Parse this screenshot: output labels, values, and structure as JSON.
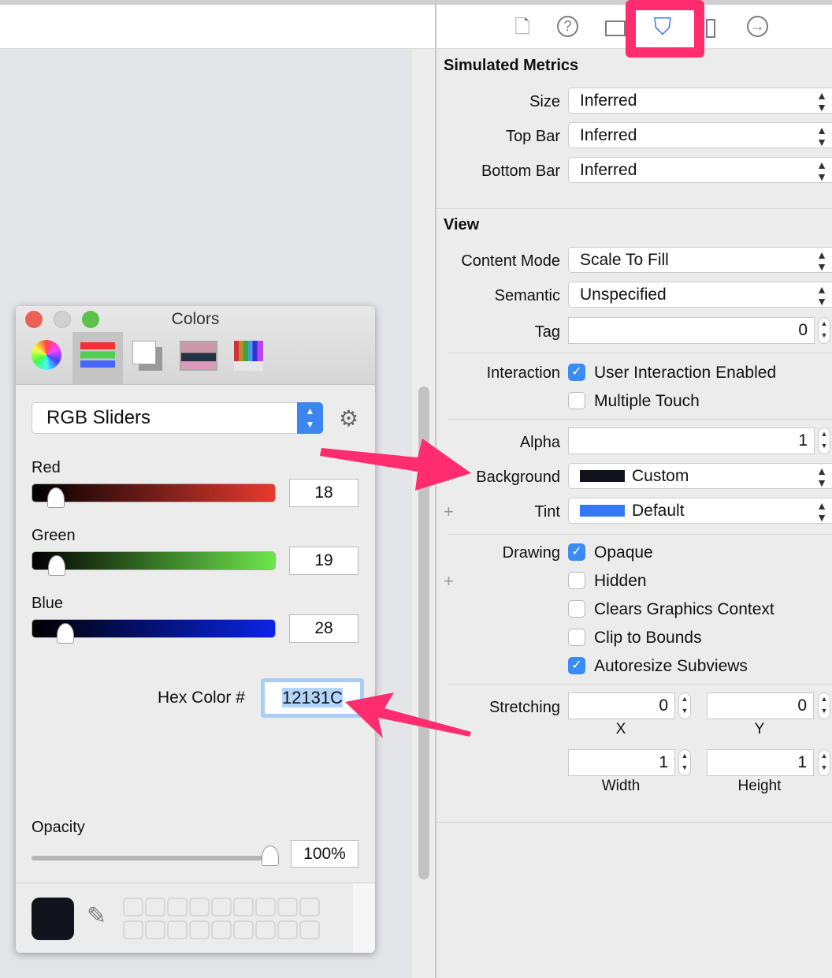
{
  "toolbar": {
    "icons": [
      "file-icon",
      "help-icon",
      "identity-icon",
      "attributes-icon",
      "size-ruler-icon",
      "connections-icon"
    ],
    "selected": "attributes-icon",
    "highlight_color": "#ff2d6f"
  },
  "inspector": {
    "simulated_metrics": {
      "title": "Simulated Metrics",
      "rows": [
        {
          "label": "Size",
          "value": "Inferred"
        },
        {
          "label": "Top Bar",
          "value": "Inferred"
        },
        {
          "label": "Bottom Bar",
          "value": "Inferred"
        }
      ]
    },
    "view": {
      "title": "View",
      "content_mode": {
        "label": "Content Mode",
        "value": "Scale To Fill"
      },
      "semantic": {
        "label": "Semantic",
        "value": "Unspecified"
      },
      "tag": {
        "label": "Tag",
        "value": "0"
      },
      "interaction": {
        "label": "Interaction",
        "options": [
          {
            "label": "User Interaction Enabled",
            "checked": true
          },
          {
            "label": "Multiple Touch",
            "checked": false
          }
        ]
      },
      "alpha": {
        "label": "Alpha",
        "value": "1"
      },
      "background": {
        "label": "Background",
        "value": "Custom",
        "swatch": "#12131c"
      },
      "tint": {
        "label": "Tint",
        "value": "Default",
        "swatch": "#3478f6"
      },
      "drawing": {
        "label": "Drawing",
        "options": [
          {
            "label": "Opaque",
            "checked": true
          },
          {
            "label": "Hidden",
            "checked": false
          },
          {
            "label": "Clears Graphics Context",
            "checked": false
          },
          {
            "label": "Clip to Bounds",
            "checked": false
          },
          {
            "label": "Autoresize Subviews",
            "checked": true
          }
        ]
      },
      "stretching": {
        "label": "Stretching",
        "x": "0",
        "x_label": "X",
        "y": "0",
        "y_label": "Y",
        "width": "1",
        "width_label": "Width",
        "height": "1",
        "height_label": "Height"
      }
    }
  },
  "colors_panel": {
    "title": "Colors",
    "mode": "RGB Sliders",
    "tabs": [
      "color-wheel-icon",
      "sliders-icon",
      "palettes-icon",
      "image-palette-icon",
      "pencils-icon"
    ],
    "red": {
      "label": "Red",
      "value": "18"
    },
    "green": {
      "label": "Green",
      "value": "19"
    },
    "blue": {
      "label": "Blue",
      "value": "28"
    },
    "hex": {
      "label": "Hex Color #",
      "value": "12131C"
    },
    "opacity": {
      "label": "Opacity",
      "value": "100%",
      "fraction": 1.0
    },
    "current_color": "#12131c"
  }
}
